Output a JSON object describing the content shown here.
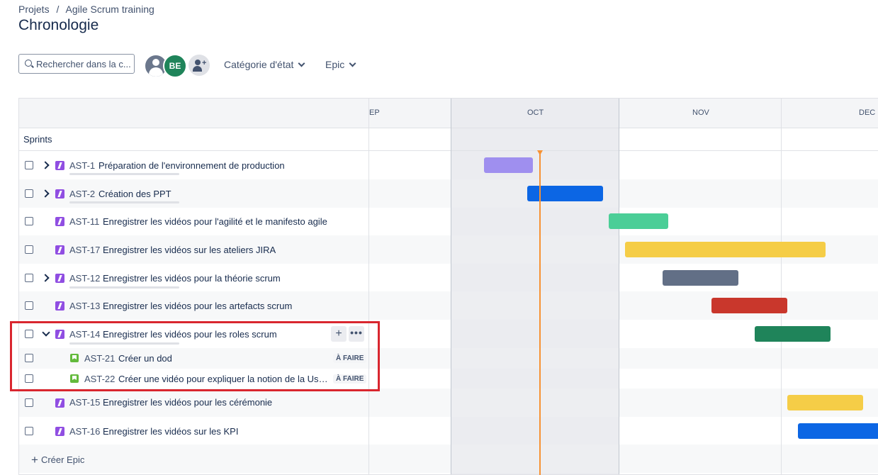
{
  "breadcrumb": {
    "items": [
      "Projets",
      "/",
      "Agile Scrum training"
    ]
  },
  "page_title": "Chronologie",
  "toolbar": {
    "search_placeholder": "Rechercher dans la c...",
    "avatars": [
      {
        "icon": "user-icon",
        "label": ""
      },
      {
        "initials": "BE",
        "color": "#1f845a"
      }
    ],
    "add_people_icon": "add-person-icon",
    "filters": [
      "Catégorie d'état",
      "Epic"
    ]
  },
  "timeline": {
    "months": [
      "EP",
      "OCT",
      "NOV",
      "DEC"
    ],
    "sprints_label": "Sprints",
    "today_color": "#f79233"
  },
  "rows": [
    {
      "key": "AST-1",
      "summary": "Préparation de l'environnement de production",
      "expand": "right",
      "type": "epic",
      "color": "#9f8fef"
    },
    {
      "key": "AST-2",
      "summary": "Création des PPT",
      "expand": "right",
      "type": "epic",
      "color": "#0c66e4"
    },
    {
      "key": "AST-11",
      "summary": "Enregistrer les vidéos pour l'agilité et le manifesto agile",
      "expand": "",
      "type": "epic",
      "color": "#4bce97"
    },
    {
      "key": "AST-17",
      "summary": "Enregistrer les vidéos sur les ateliers JIRA",
      "expand": "",
      "type": "epic",
      "color": "#f5cd47"
    },
    {
      "key": "AST-12",
      "summary": "Enregistrer les vidéos pour la théorie scrum",
      "expand": "right",
      "type": "epic",
      "color": "#626f86"
    },
    {
      "key": "AST-13",
      "summary": "Enregistrer les vidéos pour les artefacts scrum",
      "expand": "",
      "type": "epic",
      "color": "#c9372c"
    },
    {
      "key": "AST-14",
      "summary": "Enregistrer les vidéos pour les roles scrum",
      "expand": "down",
      "type": "epic",
      "color": "#1f845a"
    },
    {
      "key": "AST-21",
      "summary": "Créer un dod",
      "type": "story",
      "status": "À FAIRE"
    },
    {
      "key": "AST-22",
      "summary": "Créer une vidéo pour expliquer la notion de la User...",
      "type": "story",
      "status": "À FAIRE"
    },
    {
      "key": "AST-15",
      "summary": "Enregistrer les vidéos pour les cérémonie",
      "expand": "",
      "type": "epic",
      "color": "#f5cd47"
    },
    {
      "key": "AST-16",
      "summary": "Enregistrer les vidéos sur les KPI",
      "expand": "",
      "type": "epic",
      "color": "#0c66e4"
    }
  ],
  "row_actions": {
    "add_label": "+",
    "more_label": "•••"
  },
  "create_epic_label": "Créer Epic",
  "highlight_color": "#d9262f"
}
